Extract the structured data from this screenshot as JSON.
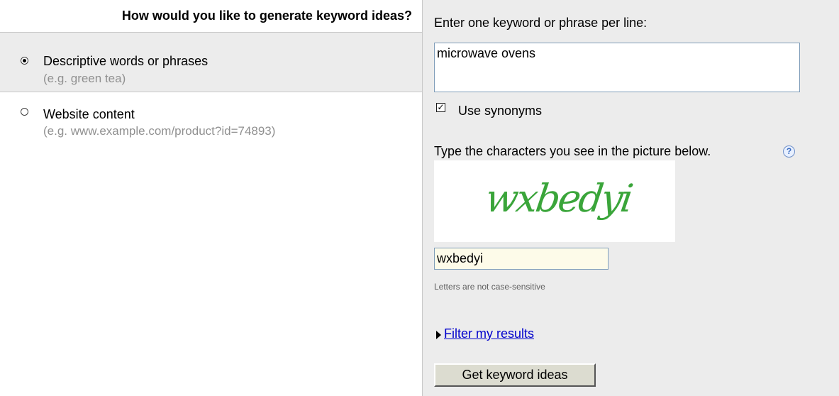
{
  "left": {
    "heading": "How would you like to generate keyword ideas?",
    "options": [
      {
        "label": "Descriptive words or phrases",
        "hint": "(e.g. green tea)",
        "selected": true
      },
      {
        "label": "Website content",
        "hint": "(e.g. www.example.com/product?id=74893)",
        "selected": false
      }
    ]
  },
  "right": {
    "prompt": "Enter one keyword or phrase per line:",
    "keywords_value": "microwave ovens",
    "synonyms": {
      "label": "Use synonyms",
      "checked": true
    },
    "captcha": {
      "prompt": "Type the characters you see in the picture below.",
      "help_symbol": "?",
      "image_text": "wxbedyi",
      "input_value": "wxbedyi",
      "note": "Letters are not case-sensitive"
    },
    "filter_link": "Filter my results",
    "submit_label": "Get keyword ideas"
  },
  "colors": {
    "panel_gray": "#ececec",
    "link_blue": "#0000cc",
    "captcha_green": "#3aa53a",
    "hint_gray": "#909090"
  }
}
